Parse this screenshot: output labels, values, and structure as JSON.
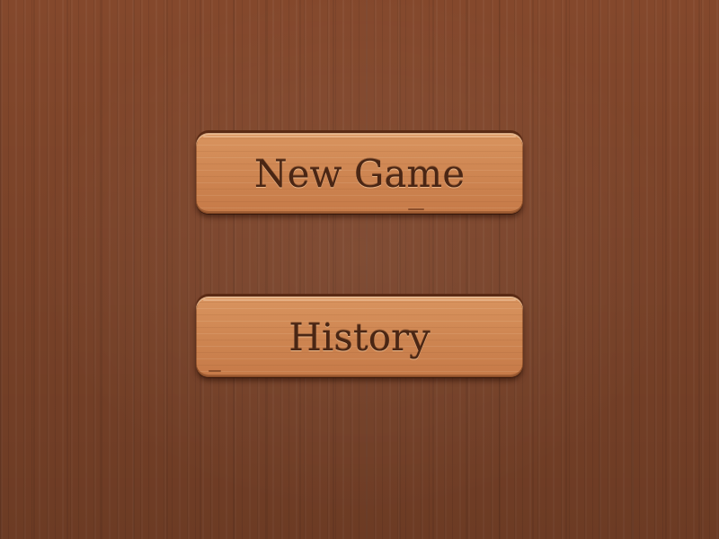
{
  "screen": {
    "name": "main-menu",
    "background_color": "#84482c",
    "plank_color": "#d08a56",
    "label_color": "#4a2614"
  },
  "menu": {
    "buttons": [
      {
        "label": "New Game"
      },
      {
        "label": "History"
      }
    ]
  }
}
